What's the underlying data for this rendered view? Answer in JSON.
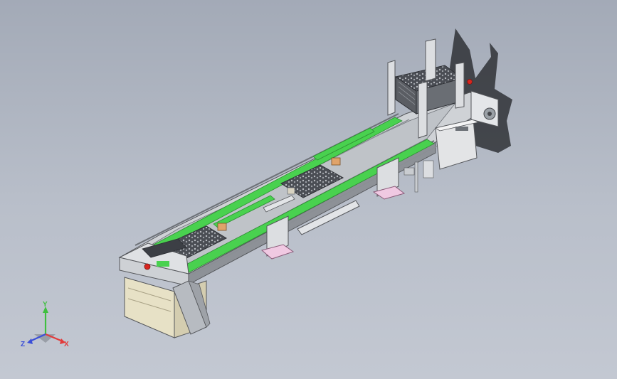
{
  "triad": {
    "y_label": "Y",
    "x_label": "X",
    "z_label": "Z",
    "y_color": "#3fbf3f",
    "x_color": "#e23b3b",
    "z_color": "#3b4fd8"
  },
  "colors": {
    "belt_green": "#49d14f",
    "frame_gray": "#c9ccd0",
    "steel_dark": "#6d7177",
    "cabinet_beige": "#e7e1c6",
    "foot_pink": "#f0c9e2",
    "pallet_dark": "#3c3f45",
    "shadow": "#2f3136",
    "estop_red": "#d8261f"
  }
}
